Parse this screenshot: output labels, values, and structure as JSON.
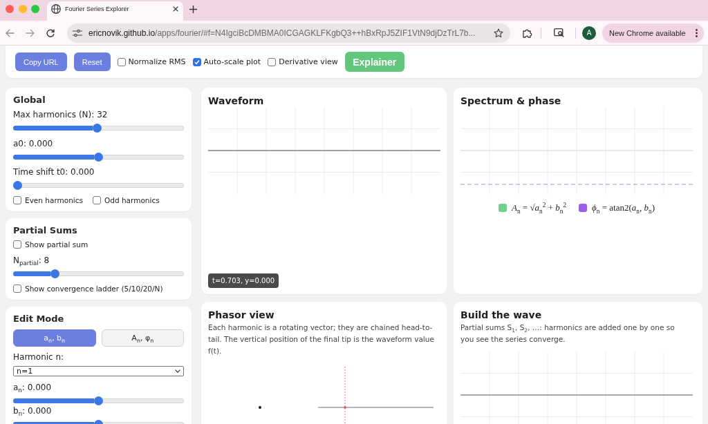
{
  "browser": {
    "tab": {
      "title": "Fourier Series Explorer"
    },
    "address_bar": {
      "host": "ericnovik.github.io",
      "path": "/apps/fourier/#f=N4IgciBcDMBMA0ICGAGKLFKgbQ3++hBxRpJ5ZIF1VtN9djDzTrL7b..."
    },
    "profile": {
      "initial": "A"
    },
    "update_button": {
      "label": "New Chrome available"
    }
  },
  "toolbar": {
    "items": [
      {
        "kind": "button",
        "label": "Copy URL"
      },
      {
        "kind": "button",
        "label": "Reset"
      },
      {
        "kind": "checkbox",
        "label": "Normalize RMS",
        "checked": false
      },
      {
        "kind": "checkbox",
        "label": "Auto-scale plot",
        "checked": true
      },
      {
        "kind": "checkbox",
        "label": "Derivative view",
        "checked": false
      },
      {
        "kind": "accent-button",
        "label": "Explainer"
      }
    ]
  },
  "sidebar": {
    "cards": [
      {
        "title": "Global",
        "controls": [
          {
            "kind": "slider",
            "label": "Max harmonics (N): 32",
            "level": 0.49
          },
          {
            "kind": "slider",
            "label": "a0: 0.000",
            "level": 0.5
          },
          {
            "kind": "slider",
            "label": "Time shift t0: 0.000",
            "level": 0
          },
          {
            "kind": "checkboxes",
            "items": [
              {
                "label": "Even harmonics",
                "checked": false
              },
              {
                "label": "Odd harmonics",
                "checked": false
              }
            ]
          }
        ]
      },
      {
        "title": "Partial Sums",
        "controls": [
          {
            "kind": "checkboxes",
            "items": [
              {
                "label": "Show partial sum",
                "checked": false
              }
            ]
          },
          {
            "kind": "slider",
            "label": "N$_{partial}$: 8",
            "level": 0.23
          },
          {
            "kind": "checkboxes",
            "items": [
              {
                "label": "Show convergence ladder (5/10/20/N)",
                "checked": false
              }
            ]
          }
        ]
      },
      {
        "title": "Edit Mode",
        "controls": [
          {
            "kind": "segmented",
            "options": [
              {
                "label": "a$_{n}$, b$_{n}$",
                "selected": true
              },
              {
                "label": "A$_{n}$, φ$_{n}$",
                "selected": false
              }
            ]
          },
          {
            "kind": "select",
            "label": "Harmonic n:",
            "value": "n=1"
          },
          {
            "kind": "slider",
            "label": "a$_{n}$: 0.000",
            "level": 0.5
          },
          {
            "kind": "slider",
            "label": "b$_{n}$: 0.000",
            "level": 0.5
          }
        ]
      }
    ]
  },
  "panels": [
    {
      "kind": "waveform",
      "title": "Waveform",
      "tooltip": "t=0.703, y=0.000"
    },
    {
      "kind": "spectrum",
      "title": "Spectrum & phase",
      "legend": [
        {
          "label": "*A*$_{n}$ = √*a*$_{n}$$^{2}$ + *b*$_{n}$$^{2}$",
          "color": "#6fd28a"
        },
        {
          "label": "*ϕ*$_{n}$ = atan2(*a*$_{n}$, *b*$_{n}$)",
          "color": "#9b5cf0"
        }
      ]
    },
    {
      "kind": "phasor",
      "title": "Phasor view",
      "description": "Each harmonic is a rotating vector; they are chained head-to-tail. The vertical position of the final tip is the waveform value f(t)."
    },
    {
      "kind": "build",
      "title": "Build the wave",
      "description": "Partial sums S$_{1}$, S$_{2}$, …: harmonics are added one by one so you see the series converge."
    }
  ]
}
